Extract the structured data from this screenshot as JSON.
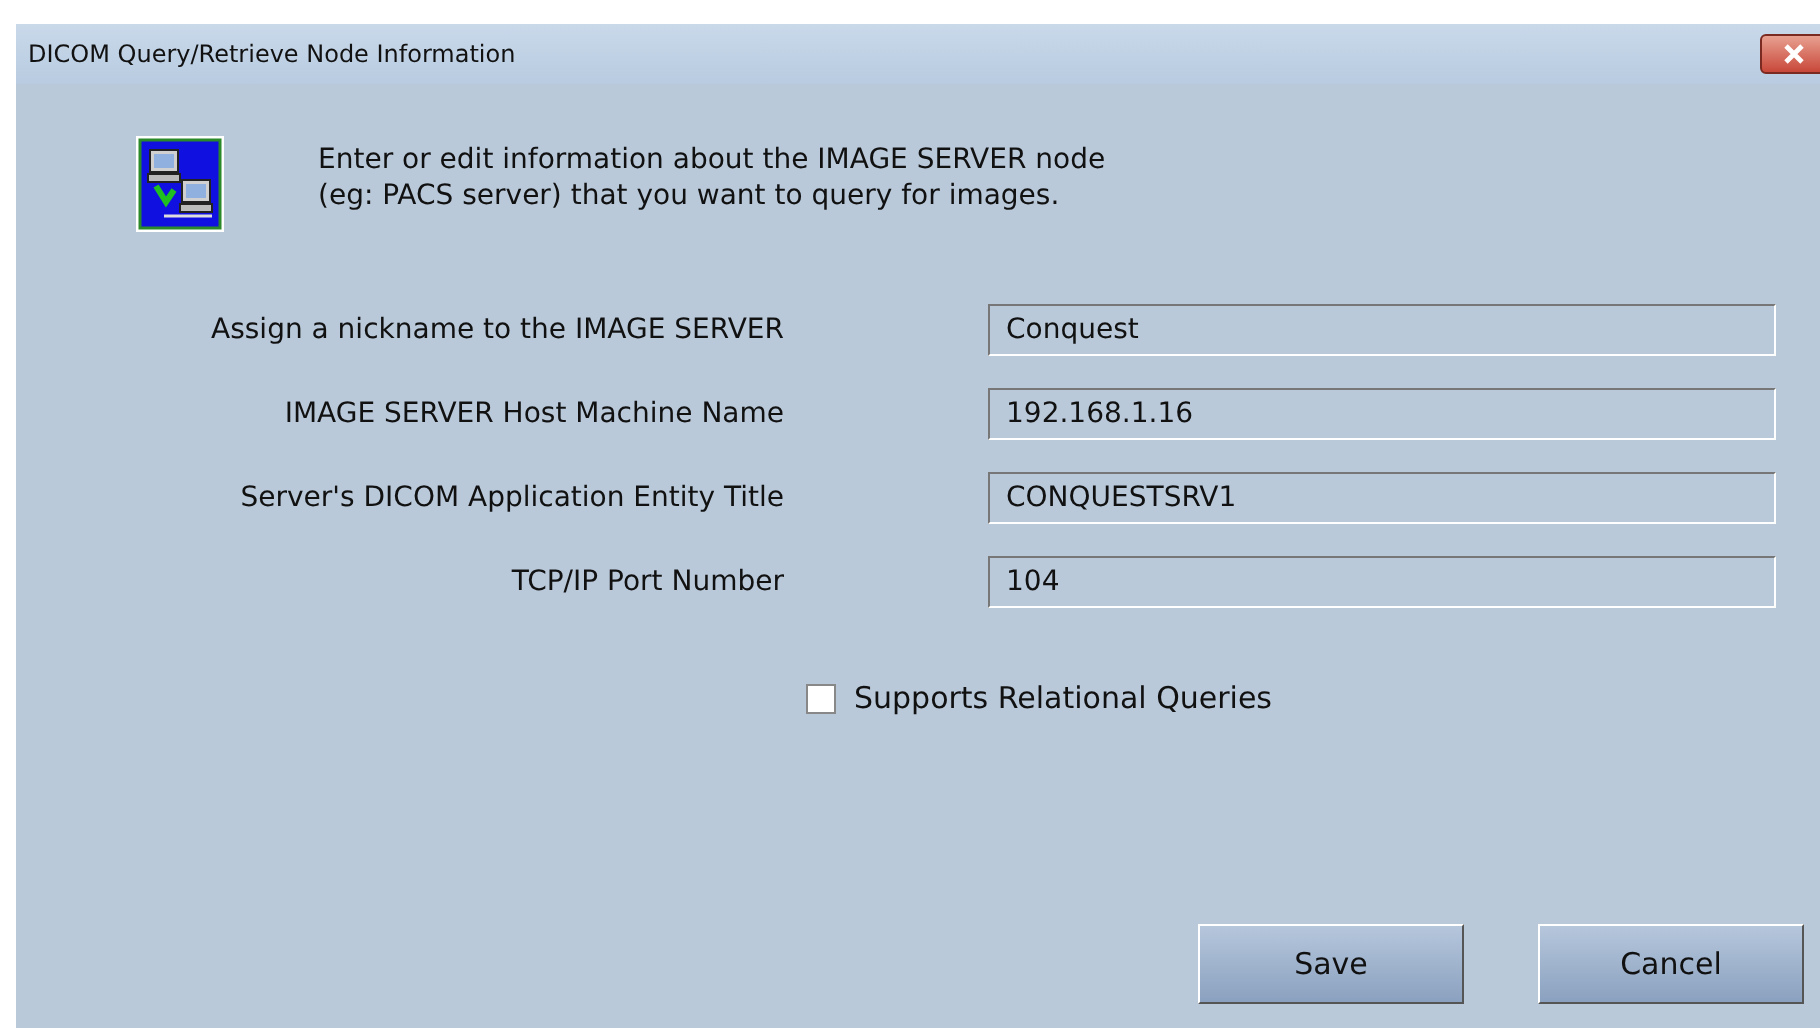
{
  "window": {
    "title": "DICOM Query/Retrieve Node Information"
  },
  "intro": [
    "Enter or edit information about the IMAGE SERVER node",
    "(eg: PACS server) that you want to query for images."
  ],
  "fields": [
    {
      "label": "Assign a nickname to the IMAGE SERVER",
      "value": "Conquest"
    },
    {
      "label": "IMAGE SERVER Host Machine Name",
      "value": "192.168.1.16"
    },
    {
      "label": "Server's DICOM Application Entity Title",
      "value": "CONQUESTSRV1"
    },
    {
      "label": "TCP/IP Port Number",
      "value": "104"
    }
  ],
  "relational": {
    "label": "Supports Relational Queries",
    "checked": false
  },
  "buttons": [
    "Save",
    "Cancel"
  ]
}
